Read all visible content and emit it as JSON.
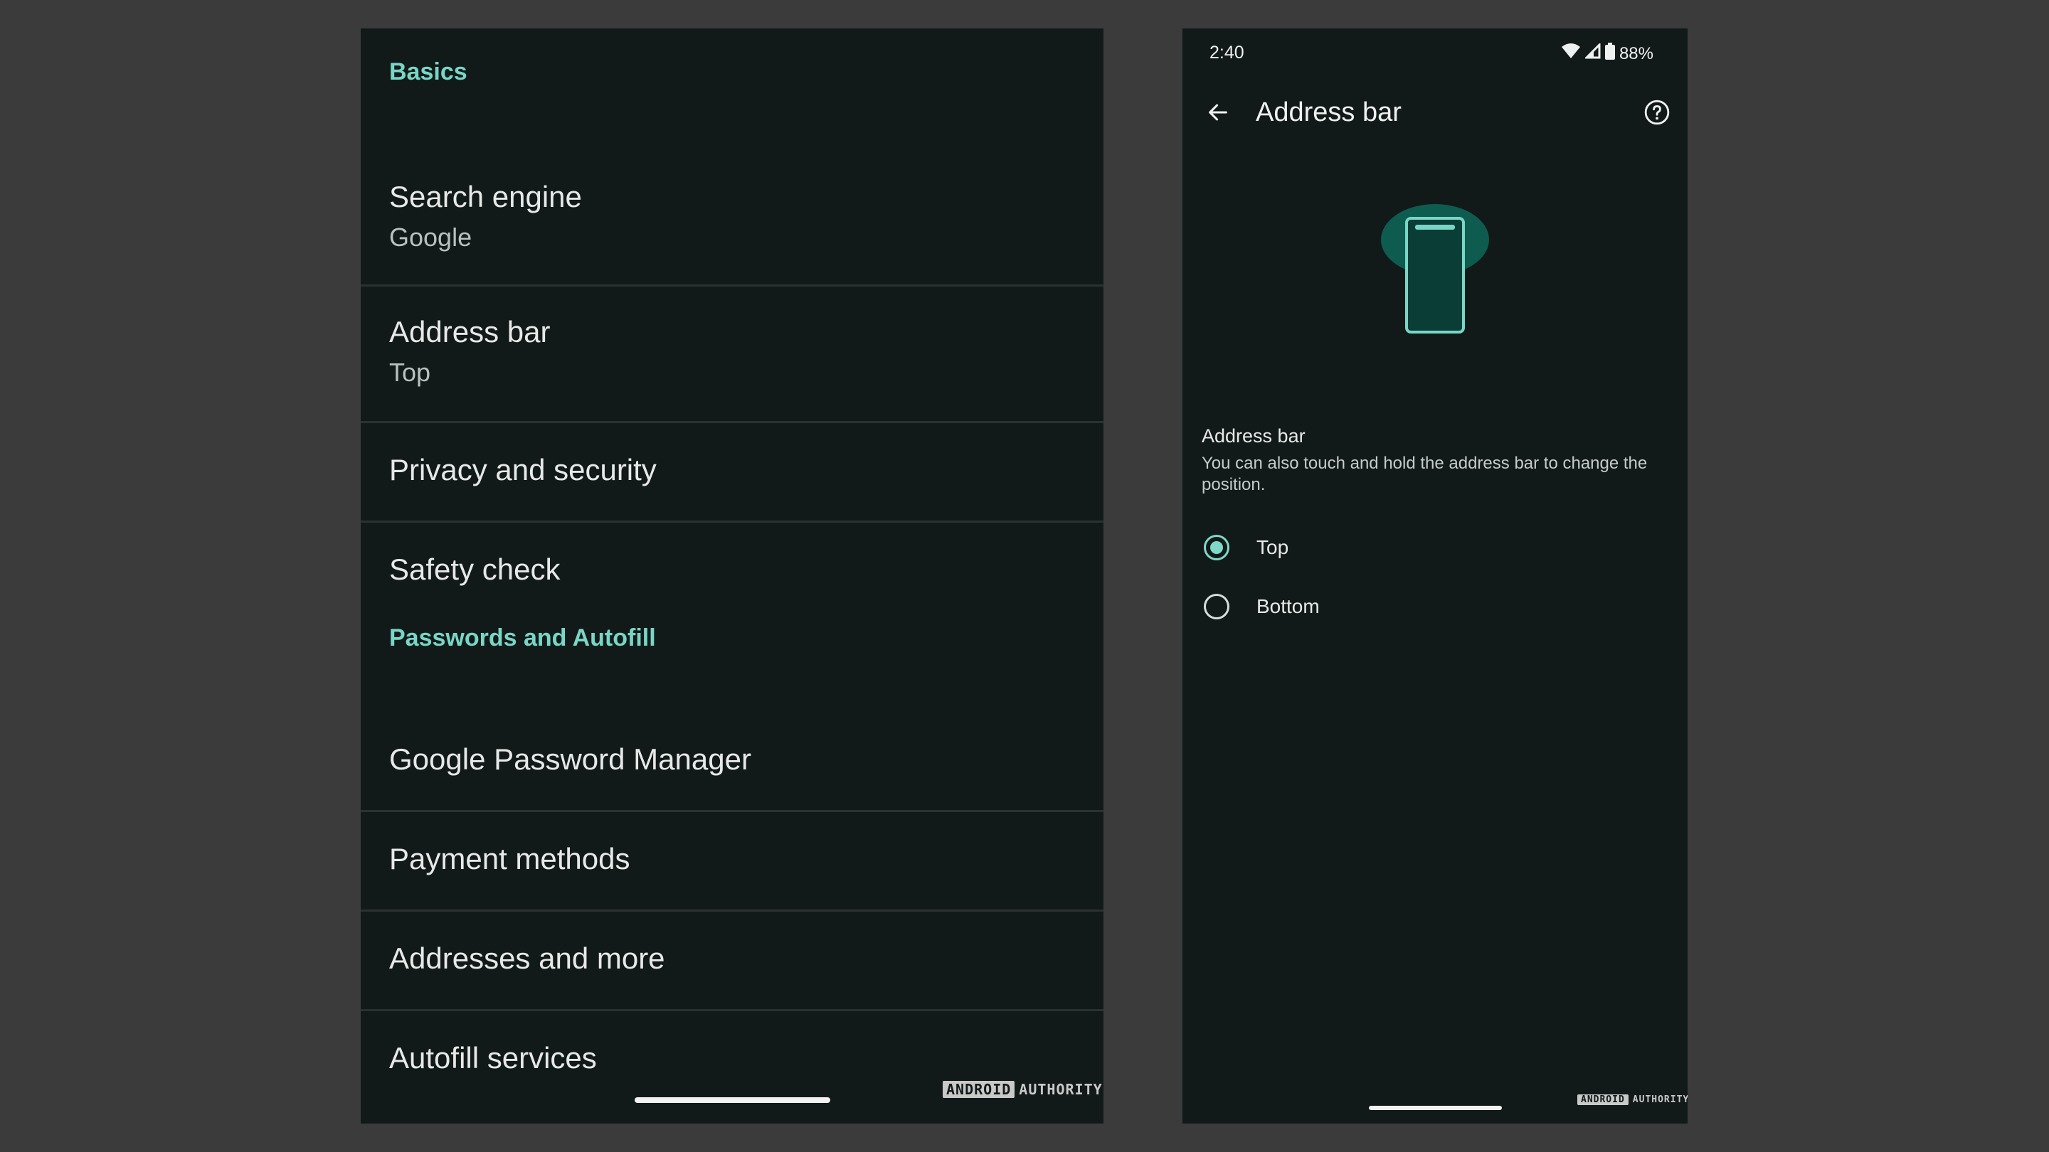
{
  "left": {
    "section_basics": "Basics",
    "search_engine": {
      "title": "Search engine",
      "value": "Google"
    },
    "address_bar": {
      "title": "Address bar",
      "value": "Top"
    },
    "privacy": "Privacy and security",
    "safety": "Safety check",
    "section_passwords": "Passwords and Autofill",
    "password_manager": "Google Password Manager",
    "payment": "Payment methods",
    "addresses": "Addresses and more",
    "autofill": "Autofill services",
    "watermark": {
      "boxed": "ANDROID",
      "plain": "AUTHORITY"
    }
  },
  "right": {
    "status": {
      "time": "2:40",
      "battery": "88%"
    },
    "title": "Address bar",
    "description_title": "Address bar",
    "description_body": "You can also touch and hold the address bar to change the position.",
    "options": [
      {
        "label": "Top",
        "selected": true
      },
      {
        "label": "Bottom",
        "selected": false
      }
    ],
    "watermark": {
      "boxed": "ANDROID",
      "plain": "AUTHORITY"
    }
  },
  "colors": {
    "accent": "#79d6c6",
    "panel_bg": "#121a19",
    "page_bg": "#3b3b3b",
    "illustration_fill": "#0e5c50",
    "illustration_phone": "#0a3d36"
  },
  "icons": {
    "back": "arrow-left-icon",
    "help": "help-circle-icon",
    "wifi": "wifi-icon",
    "signal": "cell-signal-icon",
    "battery": "battery-icon"
  }
}
